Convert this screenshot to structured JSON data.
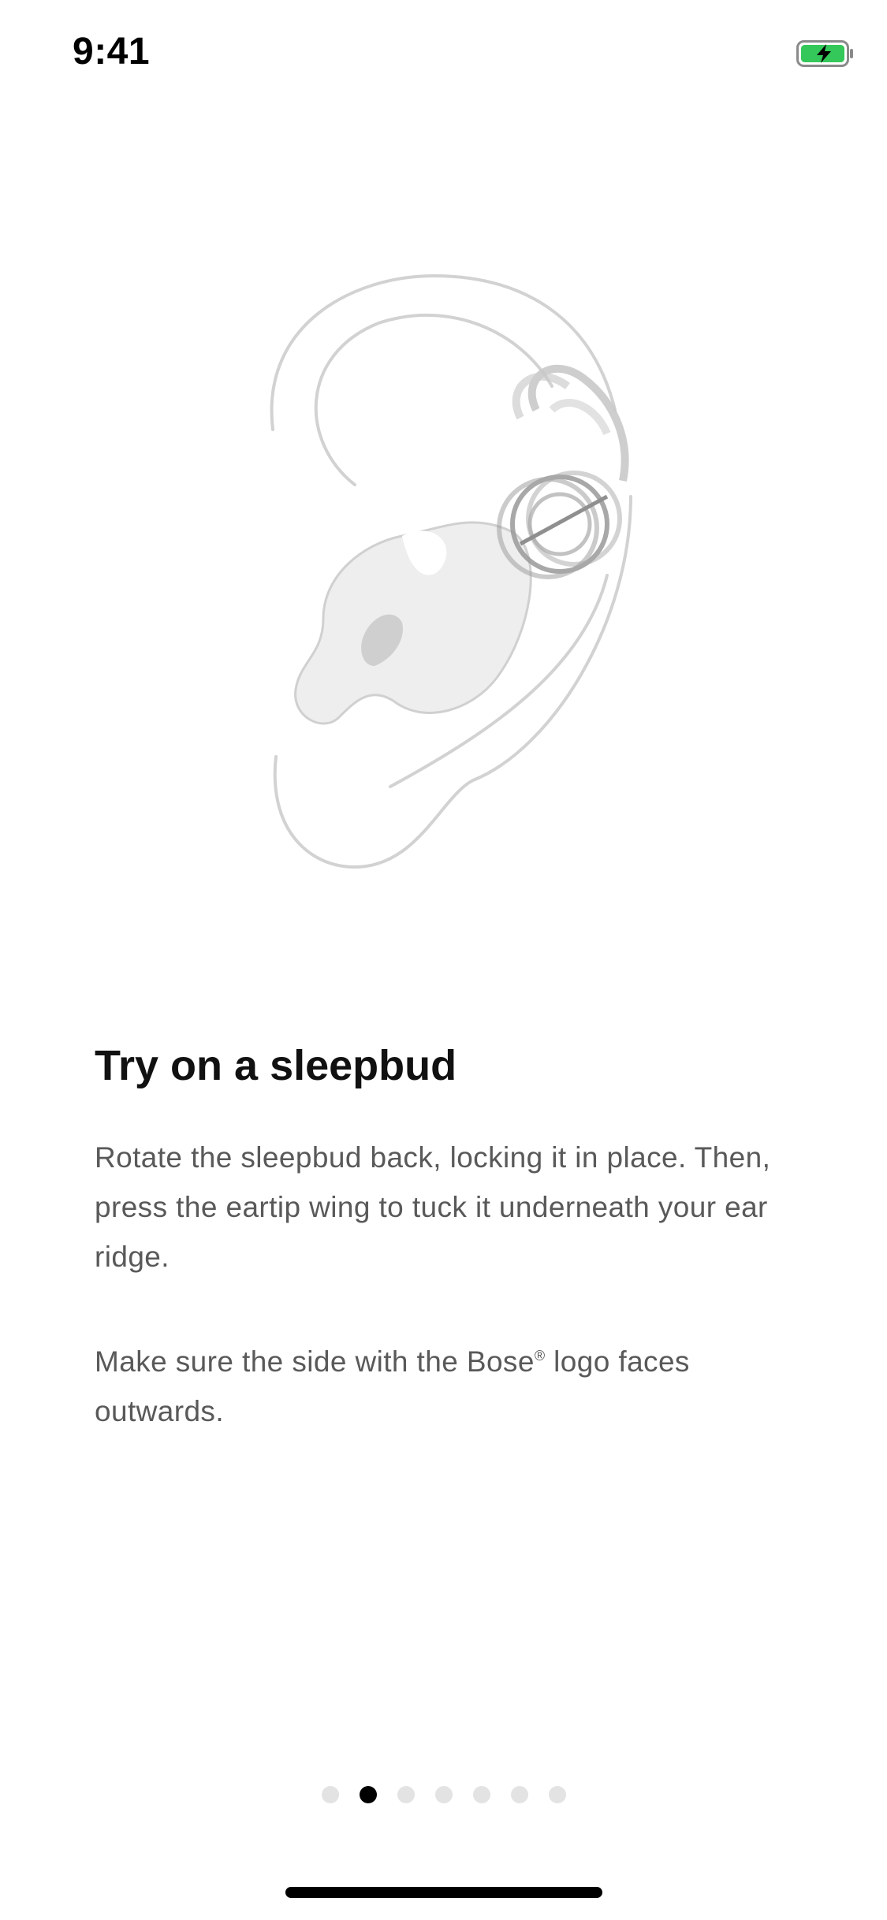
{
  "status_bar": {
    "time": "9:41",
    "battery_icon": "battery-charging-icon",
    "battery_color": "#34c759"
  },
  "illustration": {
    "icon": "ear-sleepbud-illustration"
  },
  "content": {
    "title": "Try on a sleepbud",
    "paragraph_1": "Rotate the sleepbud back, locking it in place. Then, press the eartip wing to tuck it underneath your ear ridge.",
    "paragraph_2_before": "Make sure the side with the Bose",
    "paragraph_2_mark": "®",
    "paragraph_2_after": " logo faces outwards."
  },
  "pagination": {
    "total": 7,
    "active_index": 1
  }
}
